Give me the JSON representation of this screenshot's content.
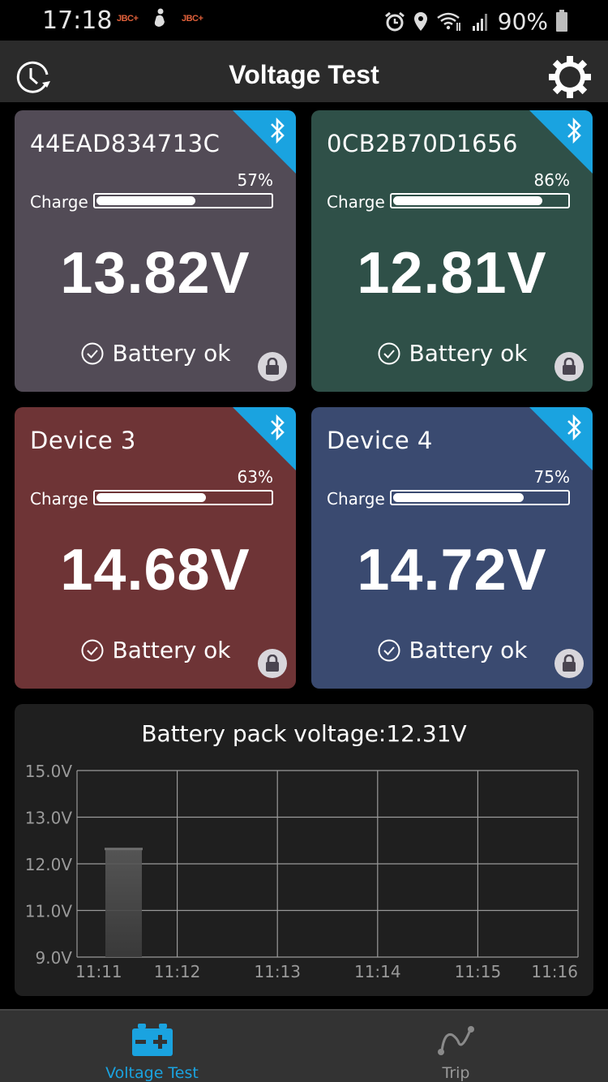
{
  "status_bar": {
    "time": "17:18",
    "notif_1": "JBC+",
    "notif_2": "JBC+",
    "battery_percent": "90%",
    "icons": [
      "alarm-icon",
      "location-icon",
      "wifi-icon",
      "signal-icon",
      "battery-icon"
    ]
  },
  "app_bar": {
    "title": "Voltage Test",
    "left_icon": "history-icon",
    "right_icon": "settings-gear-icon"
  },
  "devices": [
    {
      "name": "44EAD834713C",
      "charge_label": "Charge",
      "charge_percent": 57,
      "charge_text": "57%",
      "voltage": "13.82V",
      "status": "Battery ok",
      "color": "#524b56",
      "connection": "bluetooth",
      "locked": true
    },
    {
      "name": "0CB2B70D1656",
      "charge_label": "Charge",
      "charge_percent": 86,
      "charge_text": "86%",
      "voltage": "12.81V",
      "status": "Battery ok",
      "color": "#2f5048",
      "connection": "bluetooth",
      "locked": true
    },
    {
      "name": "Device 3",
      "charge_label": "Charge",
      "charge_percent": 63,
      "charge_text": "63%",
      "voltage": "14.68V",
      "status": "Battery ok",
      "color": "#6e3436",
      "connection": "bluetooth",
      "locked": true
    },
    {
      "name": "Device 4",
      "charge_label": "Charge",
      "charge_percent": 75,
      "charge_text": "75%",
      "voltage": "14.72V",
      "status": "Battery ok",
      "color": "#3a4a70",
      "connection": "bluetooth",
      "locked": true
    }
  ],
  "colors": {
    "accent": "#1aa3e0",
    "background": "#000000",
    "app_bar": "#2b2b2b",
    "chart_panel": "#1f1f1f",
    "nav_bar": "#333333"
  },
  "chart_data": {
    "type": "bar",
    "title": "Battery pack voltage:12.31V",
    "xlabel": "",
    "ylabel": "",
    "x_ticks": [
      "11:11",
      "11:12",
      "11:13",
      "11:14",
      "11:15",
      "11:16"
    ],
    "y_ticks": [
      "9.0V",
      "11.0V",
      "12.0V",
      "13.0V",
      "15.0V"
    ],
    "y_tick_values": [
      9.0,
      11.0,
      12.0,
      13.0,
      15.0
    ],
    "ylim": [
      9.0,
      15.0
    ],
    "grid": true,
    "series": [
      {
        "name": "Battery pack voltage",
        "points": [
          {
            "x": "11:11",
            "value": 12.31
          }
        ]
      }
    ]
  },
  "bottom_nav": {
    "items": [
      {
        "label": "Voltage Test",
        "icon": "battery-icon",
        "active": true
      },
      {
        "label": "Trip",
        "icon": "trip-route-icon",
        "active": false
      }
    ]
  }
}
